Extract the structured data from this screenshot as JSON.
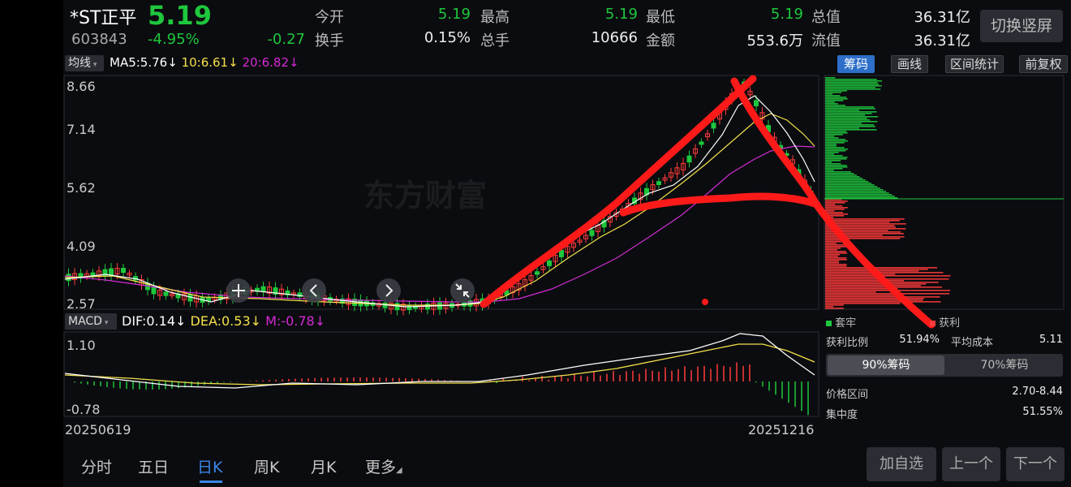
{
  "stock": {
    "name": "*ST正平",
    "code": "603843",
    "price": "5.19",
    "change_pct": "-4.95%",
    "change": "-0.27"
  },
  "quote": [
    {
      "label": "今开",
      "value": "5.19",
      "color": "green"
    },
    {
      "label": "最高",
      "value": "5.19",
      "color": "green"
    },
    {
      "label": "最低",
      "value": "5.19",
      "color": "green"
    },
    {
      "label": "总值",
      "value": "36.31亿",
      "color": "white"
    },
    {
      "label": "换手",
      "value": "0.15%",
      "color": "white"
    },
    {
      "label": "总手",
      "value": "10666",
      "color": "white"
    },
    {
      "label": "金额",
      "value": "553.6万",
      "color": "white"
    },
    {
      "label": "流值",
      "value": "36.31亿",
      "color": "white"
    }
  ],
  "switch_button": "切换竖屏",
  "ma_bar": {
    "dropdown": "均线",
    "ma5": "MA5:5.76",
    "ma10": "10:6.61",
    "ma20": "20:6.82"
  },
  "price_axis": [
    "8.66",
    "7.14",
    "5.62",
    "4.09",
    "2.57"
  ],
  "watermark": "东方财富",
  "macd_bar": {
    "dropdown": "MACD",
    "dif": "DIF:0.14",
    "dea": "DEA:0.53",
    "m": "M:-0.78"
  },
  "macd_axis": [
    "1.10",
    "-0.78"
  ],
  "dates": {
    "start": "20250619",
    "end": "20251216"
  },
  "right_tabs": [
    "筹码",
    "画线",
    "区间统计",
    "前复权"
  ],
  "chip_legend": {
    "trapped": "套牢",
    "profit": "获利"
  },
  "chip_stats": {
    "profit_ratio_label": "获利比例",
    "profit_ratio": "51.94%",
    "avg_cost_label": "平均成本",
    "avg_cost": "5.11",
    "tab90": "90%筹码",
    "tab70": "70%筹码",
    "range_label": "价格区间",
    "range": "2.70-8.44",
    "concentration_label": "集中度",
    "concentration": "51.55%"
  },
  "bottom_tabs": [
    "分时",
    "五日",
    "日K",
    "周K",
    "月K",
    "更多"
  ],
  "bottom_buttons": [
    "加自选",
    "上一个",
    "下一个"
  ],
  "colors": {
    "up": "#ff3b3b",
    "down": "#1ec73d",
    "ma5": "#ffffff",
    "ma10": "#f3e04a",
    "ma20": "#d42bd6",
    "accent": "#2d6fc9"
  }
}
